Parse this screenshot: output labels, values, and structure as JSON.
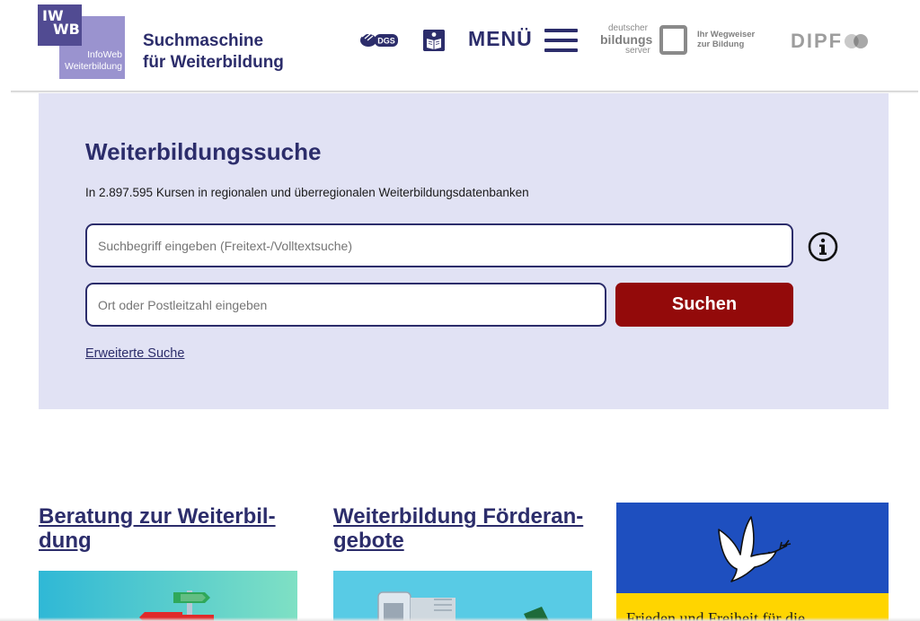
{
  "header": {
    "logo": {
      "line1": "IW",
      "line2": "WB",
      "text1": "InfoWeb",
      "text2": "Weiterbildung"
    },
    "site_title_line1": "Suchmaschine",
    "site_title_line2": "für Weiterbildung",
    "dgs_label": "DGS",
    "dgs_icon": "sign-language-icon",
    "easy_language_icon": "easy-language-icon",
    "menu_label": "MENÜ",
    "menu_icon": "hamburger-menu-icon",
    "dbs_logo": {
      "deutscher": "deutscher",
      "bildungs": "bildungs",
      "server": "server",
      "tag_line1": "Ihr Wegweiser",
      "tag_line2": "zur Bildung"
    },
    "dipf_label": "DIPF"
  },
  "search": {
    "heading": "Weiterbildungssuche",
    "subtitle": "In 2.897.595 Kursen in regionalen und überregionalen Weiterbildungsdatenbanken",
    "query_placeholder": "Suchbegriff eingeben (Freitext-/Volltextsuche)",
    "location_placeholder": "Ort oder Postleitzahl eingeben",
    "info_icon": "info-icon",
    "button_label": "Suchen",
    "advanced_link": "Erweiterte Suche"
  },
  "teasers": [
    {
      "title_line1": "Beratung zur Weiterbil-",
      "title_line2": "dung",
      "image_icon": "signpost-illustration"
    },
    {
      "title_line1": "Weiterbildung Förderan-",
      "title_line2": "gebote",
      "image_icon": "phone-money-illustration"
    },
    {
      "text": "Frieden und Freiheit für die",
      "image_icon": "peace-dove-icon"
    }
  ],
  "colors": {
    "brand_dark": "#2c2d6b",
    "search_panel_bg": "#e1e2f4",
    "search_button_bg": "#930a0a",
    "ukraine_blue": "#1e4fbf",
    "ukraine_yellow": "#ffd500"
  }
}
